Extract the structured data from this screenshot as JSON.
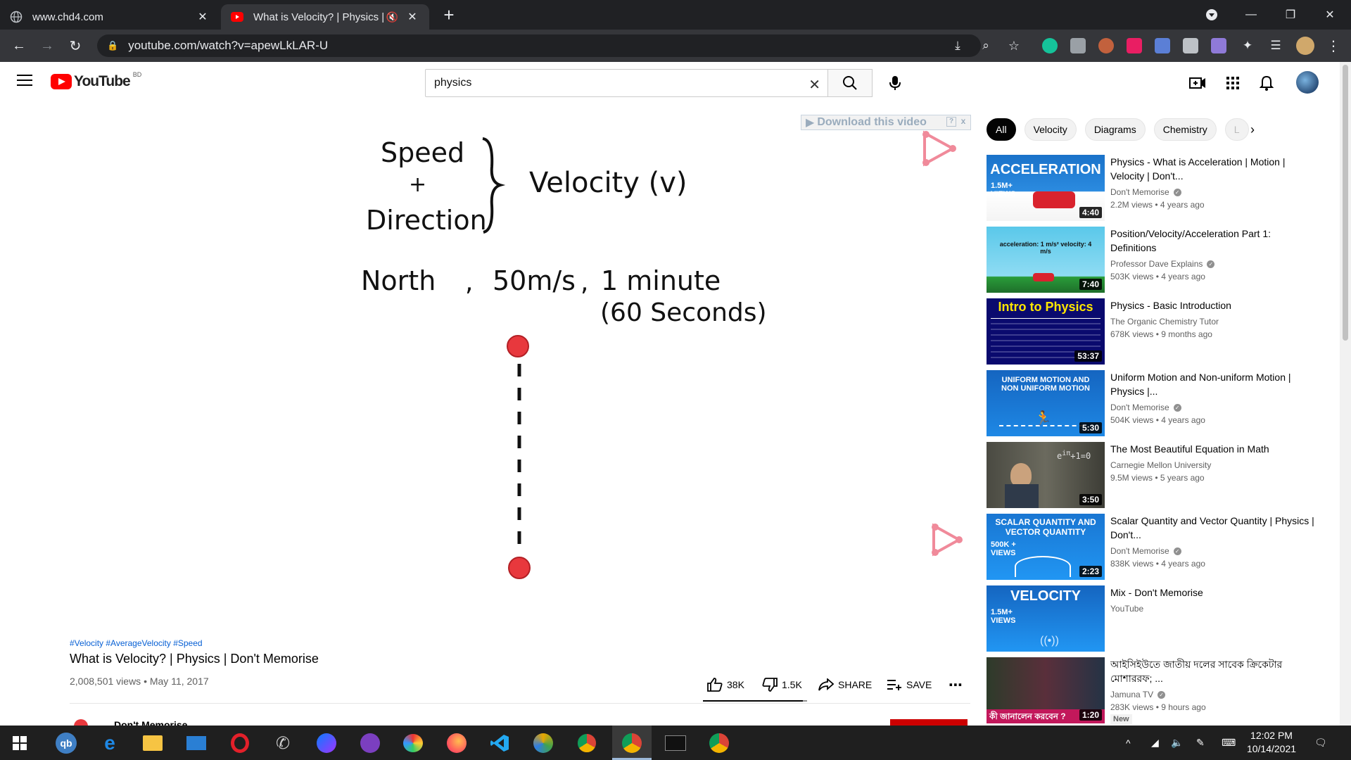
{
  "browser": {
    "tabs": [
      {
        "label": "www.chd4.com"
      },
      {
        "label": "What is Velocity? | Physics | D"
      }
    ],
    "url": "youtube.com/watch?v=apewLkLAR-U"
  },
  "youtube": {
    "logo_text": "YouTube",
    "country_code": "BD",
    "search_value": "physics"
  },
  "video": {
    "slide": {
      "speed": "Speed",
      "plus": "+",
      "direction": "Direction",
      "velocity": "Velocity (v)",
      "north": "North",
      "comma1": ",",
      "speed_value": "50m/s",
      "comma2": ",",
      "time": "1 minute",
      "time_seconds": "(60 Seconds)"
    },
    "download_banner": "Download this video",
    "download_help": "?",
    "download_close": "x",
    "hashtags": "#Velocity #AverageVelocity #Speed",
    "title": "What is Velocity? | Physics | Don't Memorise",
    "meta": "2,008,501 views • May 11, 2017",
    "likes": "38K",
    "dislikes": "1.5K",
    "share_label": "SHARE",
    "save_label": "SAVE",
    "like_ratio": 0.96,
    "channel_partial": "Don't Memorise"
  },
  "chips": [
    "All",
    "Velocity",
    "Diagrams",
    "Chemistry",
    "L"
  ],
  "recommendations": [
    {
      "title": "Physics - What is Acceleration | Motion | Velocity | Don't...",
      "channel": "Don't Memorise",
      "verified": true,
      "stats": "2.2M views • 4 years ago",
      "duration": "4:40",
      "thumb_text": "ACCELERATION",
      "thumb_sub": "1.5M+ VIEWS"
    },
    {
      "title": "Position/Velocity/Acceleration Part 1: Definitions",
      "channel": "Professor Dave Explains",
      "verified": true,
      "stats": "503K views • 4 years ago",
      "duration": "7:40",
      "thumb_text": "acceleration: 1 m/s²   velocity: 4 m/s",
      "thumb_sub": ""
    },
    {
      "title": "Physics - Basic Introduction",
      "channel": "The Organic Chemistry Tutor",
      "verified": false,
      "stats": "678K views • 9 months ago",
      "duration": "53:37",
      "thumb_text": "Intro to Physics",
      "thumb_sub": ""
    },
    {
      "title": "Uniform Motion and Non-uniform Motion | Physics |...",
      "channel": "Don't Memorise",
      "verified": true,
      "stats": "504K views • 4 years ago",
      "duration": "5:30",
      "thumb_text": "UNIFORM MOTION AND NON UNIFORM MOTION",
      "thumb_sub": ""
    },
    {
      "title": "The Most Beautiful Equation in Math",
      "channel": "Carnegie Mellon University",
      "verified": false,
      "stats": "9.5M views • 5 years ago",
      "duration": "3:50",
      "thumb_text": "",
      "thumb_sub": ""
    },
    {
      "title": "Scalar Quantity and Vector Quantity | Physics | Don't...",
      "channel": "Don't Memorise",
      "verified": true,
      "stats": "838K views • 4 years ago",
      "duration": "2:23",
      "thumb_text": "SCALAR QUANTITY AND VECTOR QUANTITY",
      "thumb_sub": "500K + VIEWS"
    },
    {
      "title": "Mix - Don't Memorise",
      "channel": "YouTube",
      "verified": false,
      "stats": "",
      "duration": "",
      "thumb_text": "VELOCITY",
      "thumb_sub": "1.5M+ VIEWS"
    },
    {
      "title": "আইসিইউতে জাতীয় দলের সাবেক ক্রিকেটার মোশাররফ; ...",
      "channel": "Jamuna TV",
      "verified": true,
      "stats": "283K views • 9 hours ago",
      "duration": "1:20",
      "thumb_text": "কী জানালেন করবেন ?",
      "thumb_sub": "",
      "badge": "New"
    }
  ],
  "taskbar": {
    "time": "12:02 PM",
    "date": "10/14/2021"
  },
  "colors": {
    "youtube_red": "#ff0000",
    "link_blue": "#065fd4",
    "chrome_dark": "#202124",
    "taskbar": "#1f1f1f",
    "slide_dot": "#e8383d"
  }
}
